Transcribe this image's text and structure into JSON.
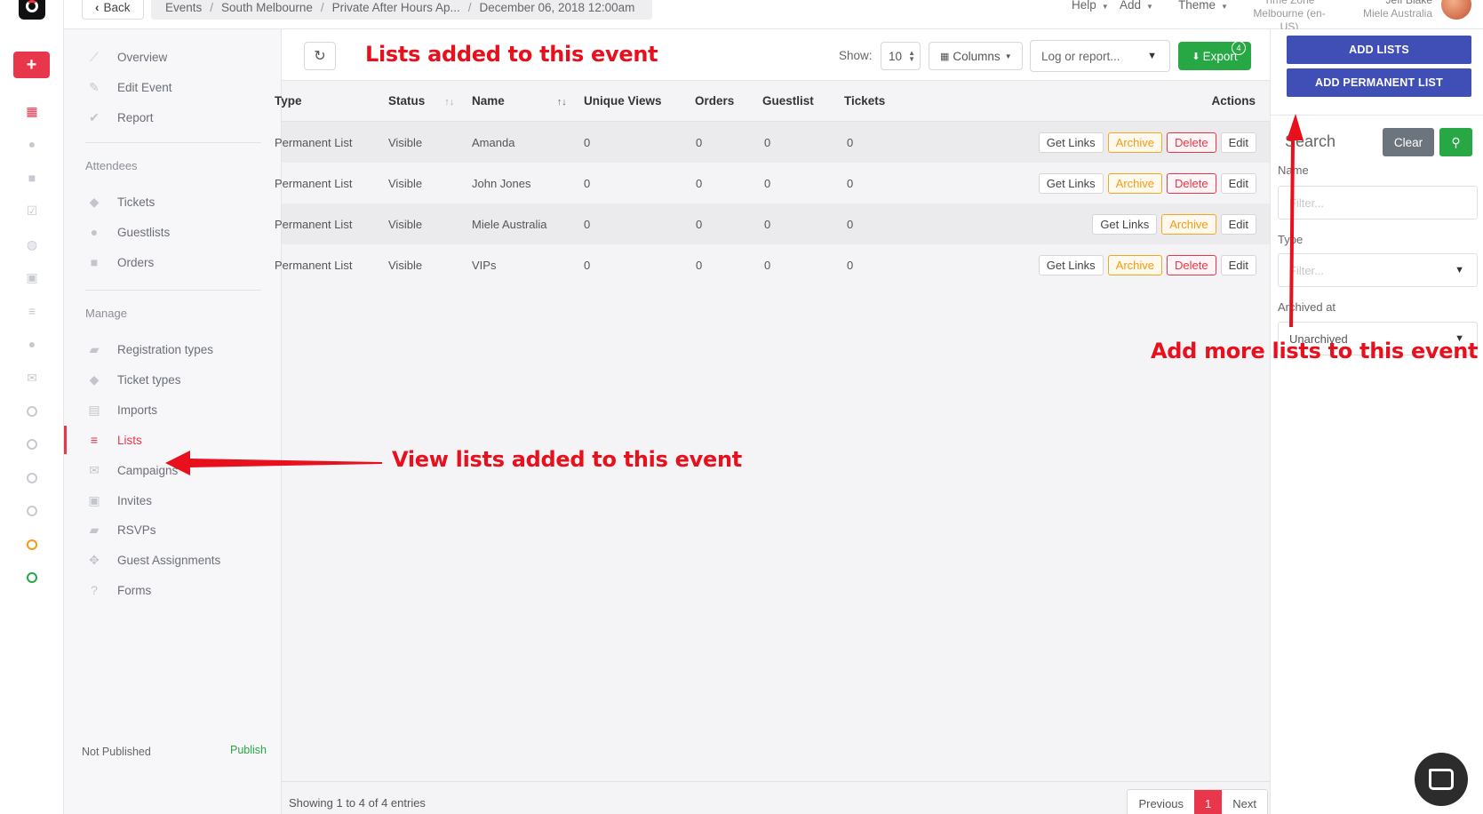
{
  "topbar": {
    "back_label": "Back",
    "breadcrumbs": [
      "Events",
      "South Melbourne",
      "Private After Hours Ap...",
      "December 06, 2018 12:00am"
    ],
    "menu": {
      "help": "Help",
      "add": "Add",
      "theme": "Theme"
    },
    "timezone_label": "Time Zone",
    "timezone_value": "Melbourne (en-US)",
    "user_name": "Jeff Blake",
    "user_org": "Miele Australia"
  },
  "sidebar": {
    "overview": "Overview",
    "edit_event": "Edit Event",
    "report": "Report",
    "attendees_label": "Attendees",
    "tickets": "Tickets",
    "guestlists": "Guestlists",
    "orders": "Orders",
    "manage_label": "Manage",
    "registration_types": "Registration types",
    "ticket_types": "Ticket types",
    "imports": "Imports",
    "lists": "Lists",
    "campaigns": "Campaigns",
    "invites": "Invites",
    "rsvps": "RSVPs",
    "guest_assignments": "Guest Assignments",
    "forms": "Forms",
    "status": "Not Published",
    "publish": "Publish"
  },
  "toolbar": {
    "show_label": "Show:",
    "show_value": "10",
    "columns_label": "Columns",
    "log_placeholder": "Log or report...",
    "export_label": "Export",
    "export_badge": "4"
  },
  "table": {
    "headers": {
      "type": "Type",
      "status": "Status",
      "name": "Name",
      "unique_views": "Unique Views",
      "orders": "Orders",
      "guestlist": "Guestlist",
      "tickets": "Tickets",
      "actions": "Actions"
    },
    "rows": [
      {
        "type": "Permanent List",
        "status": "Visible",
        "name": "Amanda",
        "unique_views": "0",
        "orders": "0",
        "guestlist": "0",
        "tickets": "0"
      },
      {
        "type": "Permanent List",
        "status": "Visible",
        "name": "John Jones",
        "unique_views": "0",
        "orders": "0",
        "guestlist": "0",
        "tickets": "0"
      },
      {
        "type": "Permanent List",
        "status": "Visible",
        "name": "Miele Australia",
        "unique_views": "0",
        "orders": "0",
        "guestlist": "0",
        "tickets": "0"
      },
      {
        "type": "Permanent List",
        "status": "Visible",
        "name": "VIPs",
        "unique_views": "0",
        "orders": "0",
        "guestlist": "0",
        "tickets": "0"
      }
    ],
    "action_labels": {
      "get_links": "Get Links",
      "archive": "Archive",
      "delete": "Delete",
      "edit": "Edit"
    }
  },
  "footer": {
    "info": "Showing 1 to 4 of 4 entries",
    "previous": "Previous",
    "page": "1",
    "next": "Next"
  },
  "right_panel": {
    "add_lists": "ADD LISTS",
    "add_permanent_list": "ADD PERMANENT LIST",
    "search_title": "Search",
    "clear": "Clear",
    "name_label": "Name",
    "name_placeholder": "Filter...",
    "type_label": "Type",
    "type_placeholder": "Filter...",
    "archived_label": "Archived at",
    "archived_value": "Unarchived"
  },
  "annotations": {
    "top": "Lists added to this event",
    "left": "View lists added to this event",
    "right": "Add more lists to this event"
  },
  "colors": {
    "accent_red": "#e8364a",
    "primary_blue": "#3f4fb5",
    "success_green": "#28a745",
    "warning_orange": "#f39c12",
    "annotation_red": "#e8101c"
  }
}
